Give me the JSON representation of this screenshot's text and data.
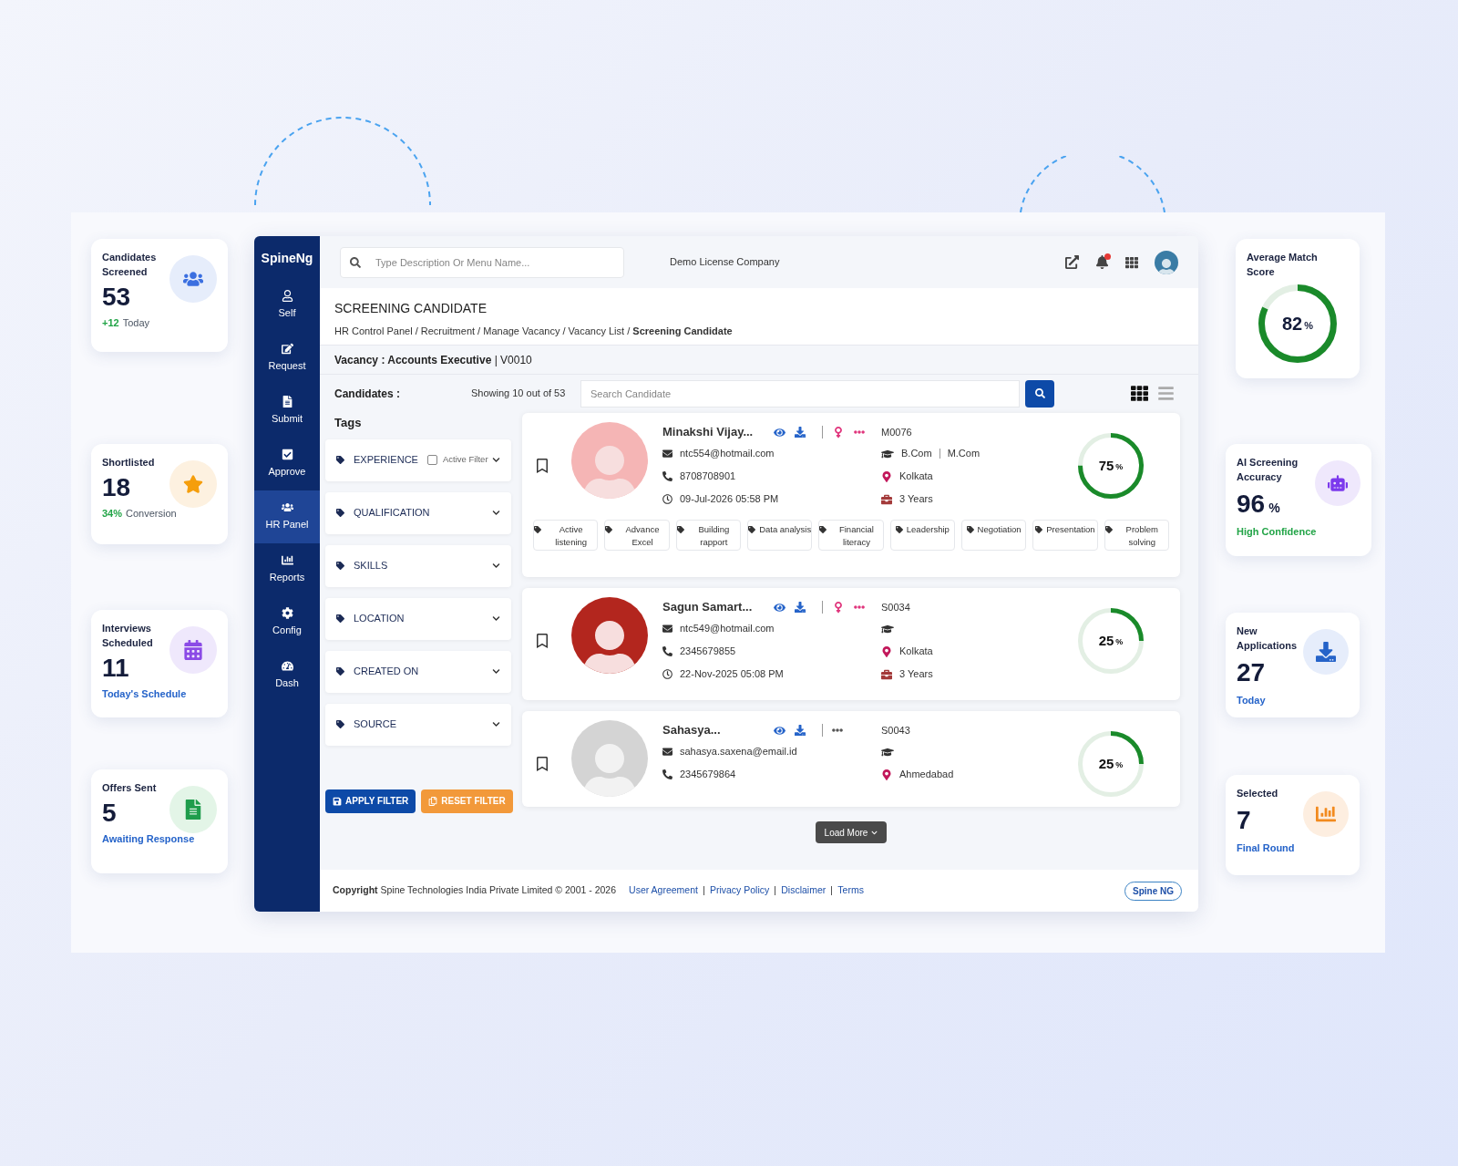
{
  "stats_left": [
    {
      "title": "Candidates Screened",
      "value": "53",
      "highlight": "+12",
      "note": "Today",
      "color": "#22a447"
    },
    {
      "title": "Shortlisted",
      "value": "18",
      "highlight": "34%",
      "note": "Conversion",
      "color": "#22a447"
    },
    {
      "title": "Interviews Scheduled",
      "value": "11",
      "note": "Today's Schedule",
      "color": "#2563c9"
    },
    {
      "title": "Offers Sent",
      "value": "5",
      "note": "Awaiting Response",
      "color": "#2563c9"
    }
  ],
  "stats_right": [
    {
      "kind": "ring",
      "title": "Average Match Score",
      "value": "82",
      "unit": "%",
      "level": 0.82
    },
    {
      "kind": "icon",
      "title": "AI Screening Accuracy",
      "value": "96",
      "unit": "%",
      "note": "High Confidence",
      "color": "#22a447"
    },
    {
      "kind": "icon",
      "title": "New Applications",
      "value": "27",
      "note": "Today",
      "color": "#2563c9"
    },
    {
      "kind": "icon",
      "title": "Selected",
      "value": "7",
      "note": "Final Round",
      "color": "#2563c9"
    }
  ],
  "sidebar": {
    "brand": "SpineNg",
    "items": [
      {
        "label": "Self",
        "selected": false
      },
      {
        "label": "Request",
        "selected": false
      },
      {
        "label": "Submit",
        "selected": false
      },
      {
        "label": "Approve",
        "selected": false
      },
      {
        "label": "HR Panel",
        "selected": true
      },
      {
        "label": "Reports",
        "selected": false
      },
      {
        "label": "Config",
        "selected": false
      },
      {
        "label": "Dash",
        "selected": false
      }
    ]
  },
  "topbar": {
    "search_placeholder": "Type Description Or Menu Name...",
    "company": "Demo License Company",
    "has_notification": true
  },
  "header": {
    "title": "SCREENING CANDIDATE",
    "breadcrumb": "HR Control Panel / Recruitment / Manage Vacancy / Vacancy List / **Screening Candidate**"
  },
  "vacancy": "**Vacancy : Accounts Executive** | V0010",
  "candidates_bar": {
    "label": "Candidates :",
    "showing": "Showing 10 out of 53",
    "search_placeholder": "Search Candidate",
    "views": [
      {
        "selected": true
      },
      {
        "selected": false
      }
    ]
  },
  "filters": {
    "title": "Tags",
    "items": [
      {
        "label": "EXPERIENCE",
        "checkbox": {
          "label": "Active Filter",
          "checked": false
        }
      },
      {
        "label": "QUALIFICATION"
      },
      {
        "label": "SKILLS"
      },
      {
        "label": "LOCATION"
      },
      {
        "label": "CREATED ON"
      },
      {
        "label": "SOURCE"
      }
    ],
    "apply": "APPLY FILTER",
    "reset": "RESET FILTER"
  },
  "candidates": [
    {
      "photo": true,
      "name": "Minakshi Vijay...",
      "gender_icon": true,
      "email": "ntc554@hotmail.com",
      "phone": "8708708901",
      "date": "09-Jul-2026 05:58 PM",
      "code": "M0076",
      "qualification": [
        "B.Com",
        "M.Com"
      ],
      "location": "Kolkata",
      "experience": "3 Years",
      "score": "75",
      "unit": "%",
      "level": 0.75,
      "skills": [
        "Active listening",
        "Advance Excel",
        "Building rapport",
        "Data analysis",
        "Financial literacy",
        "Leadership",
        "Negotiation",
        "Presentation",
        "Problem solving"
      ]
    },
    {
      "photo": true,
      "name": "Sagun Samart...",
      "gender_icon": true,
      "email": "ntc549@hotmail.com",
      "phone": "2345679855",
      "date": "22-Nov-2025 05:08 PM",
      "code": "S0034",
      "location": "Kolkata",
      "experience": "3 Years",
      "score": "25",
      "unit": "%",
      "level": 0.25
    },
    {
      "photo": false,
      "name": "Sahasya...",
      "gender_icon": false,
      "email": "sahasya.saxena@email.id",
      "phone": "2345679864",
      "code": "S0043",
      "location": "Ahmedabad",
      "score": "25",
      "unit": "%",
      "level": 0.25
    }
  ],
  "load_more": "Load More",
  "footer": {
    "copyright": "**Copyright** Spine Technologies India Private Limited © 2001 - 2026",
    "links": [
      "User Agreement",
      "Privacy Policy",
      "Disclaimer",
      "Terms"
    ],
    "badge": "Spine NG"
  }
}
